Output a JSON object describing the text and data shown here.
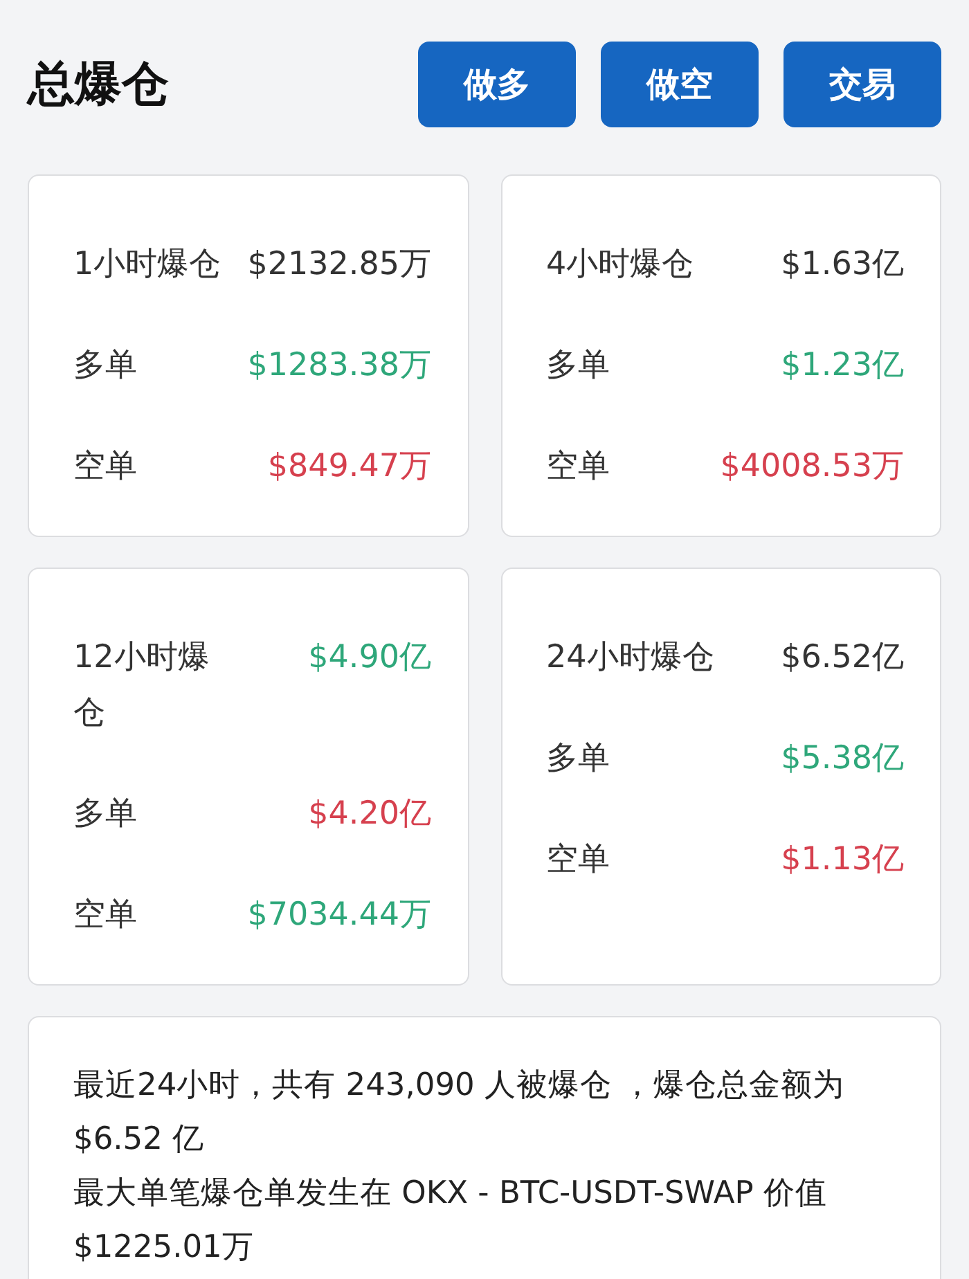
{
  "header": {
    "title": "总爆仓",
    "buttons": [
      "做多",
      "做空",
      "交易"
    ]
  },
  "cards": [
    {
      "rows": [
        {
          "label": "1小时爆仓",
          "value": "$2132.85万",
          "color": "#333333"
        },
        {
          "label": "多单",
          "value": "$1283.38万",
          "color": "#2ea77a"
        },
        {
          "label": "空单",
          "value": "$849.47万",
          "color": "#d6404e"
        }
      ]
    },
    {
      "rows": [
        {
          "label": "4小时爆仓",
          "value": "$1.63亿",
          "color": "#333333"
        },
        {
          "label": "多单",
          "value": "$1.23亿",
          "color": "#2ea77a"
        },
        {
          "label": "空单",
          "value": "$4008.53万",
          "color": "#d6404e"
        }
      ]
    },
    {
      "rows": [
        {
          "label": "12小时爆仓",
          "value": "$4.90亿",
          "color": "#2ea77a"
        },
        {
          "label": "多单",
          "value": "$4.20亿",
          "color": "#d6404e"
        },
        {
          "label": "空单",
          "value": "$7034.44万",
          "color": "#2ea77a"
        }
      ]
    },
    {
      "rows": [
        {
          "label": "24小时爆仓",
          "value": "$6.52亿",
          "color": "#333333"
        },
        {
          "label": "多单",
          "value": "$5.38亿",
          "color": "#2ea77a"
        },
        {
          "label": "空单",
          "value": "$1.13亿",
          "color": "#d6404e"
        }
      ]
    }
  ],
  "summary": [
    "最近24小时，共有 243,090 人被爆仓 ，爆仓总金额为 $6.52 亿",
    "最大单笔爆仓单发生在 OKX - BTC-USDT-SWAP 价值 $1225.01万"
  ]
}
